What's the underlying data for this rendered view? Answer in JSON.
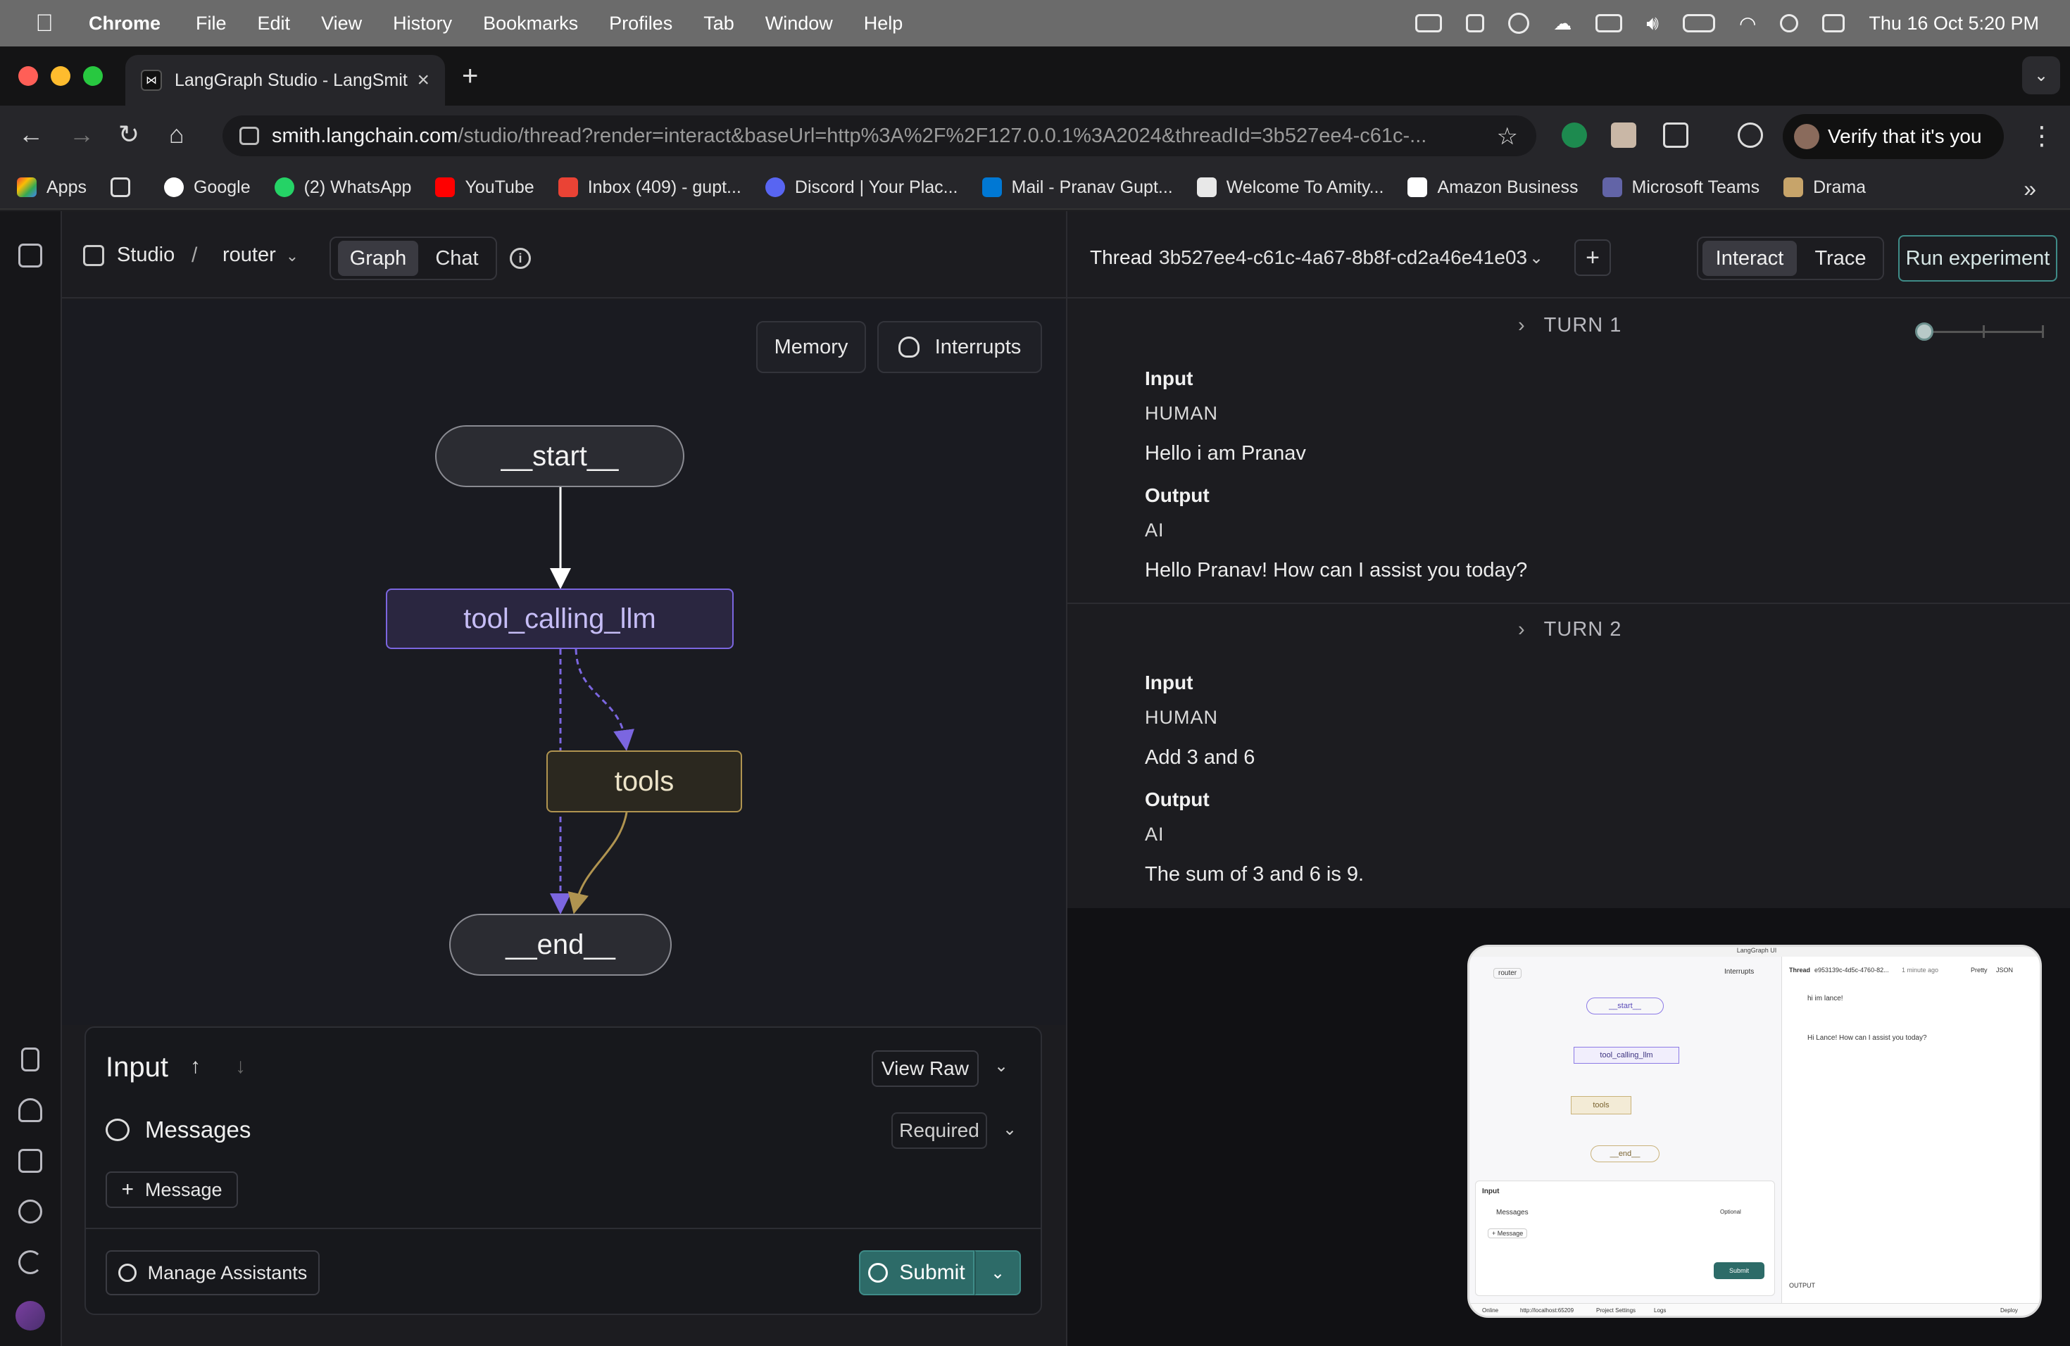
{
  "menubar": {
    "app_name": "Chrome",
    "menus": [
      "File",
      "Edit",
      "View",
      "History",
      "Bookmarks",
      "Profiles",
      "Tab",
      "Window",
      "Help"
    ],
    "clock": "Thu 16 Oct  5:20 PM"
  },
  "browser": {
    "tab_title": "LangGraph Studio - LangSmith",
    "url_host": "smith.langchain.com",
    "url_path": "/studio/thread?render=interact&baseUrl=http%3A%2F%2F127.0.0.1%3A2024&threadId=3b527ee4-c61c-...",
    "verify_label": "Verify that it's you",
    "bookmarks": [
      "Apps",
      "Google",
      "(2) WhatsApp",
      "YouTube",
      "Inbox (409) - gupt...",
      "Discord | Your Plac...",
      "Mail - Pranav Gupt...",
      "Welcome To Amity...",
      "Amazon Business",
      "Microsoft Teams",
      "Drama"
    ]
  },
  "studio": {
    "studio_label": "Studio",
    "separator": "/",
    "graph_name": "router",
    "mode_graph": "Graph",
    "mode_chat": "Chat",
    "memory_label": "Memory",
    "interrupts_label": "Interrupts",
    "nodes": {
      "start": "__start__",
      "llm": "tool_calling_llm",
      "tools": "tools",
      "end": "__end__"
    },
    "input": {
      "title": "Input",
      "view_raw": "View Raw",
      "messages_label": "Messages",
      "required_label": "Required",
      "add_message": "Message",
      "manage_assistants": "Manage Assistants",
      "submit": "Submit"
    }
  },
  "thread": {
    "label": "Thread",
    "id": "3b527ee4-c61c-4a67-8b8f-cd2a46e41e03",
    "tab_interact": "Interact",
    "tab_trace": "Trace",
    "run_experiment": "Run experiment",
    "turns": [
      {
        "header": "TURN 1",
        "input_label": "Input",
        "input_role": "HUMAN",
        "input_text": "Hello i am Pranav",
        "output_label": "Output",
        "output_role": "AI",
        "output_text": "Hello Pranav! How can I assist you today?"
      },
      {
        "header": "TURN 2",
        "input_label": "Input",
        "input_role": "HUMAN",
        "input_text": "Add 3 and 6",
        "output_label": "Output",
        "output_role": "AI",
        "output_text": "The sum of 3 and 6 is 9."
      }
    ]
  },
  "pip": {
    "title": "LangGraph UI",
    "graph_name": "router",
    "interrupts": "Interrupts",
    "thread_label": "Thread",
    "thread_id": "e953139c-4d5c-4760-82...",
    "thread_time": "1 minute ago",
    "tab_pretty": "Pretty",
    "tab_json": "JSON",
    "msg_human": "hi im lance!",
    "msg_ai": "Hi Lance! How can I assist you today?",
    "node_start": "__start__",
    "node_llm": "tool_calling_llm",
    "node_tools": "tools",
    "node_end": "__end__",
    "input_title": "Input",
    "messages": "Messages",
    "optional": "Optional",
    "add_message": "+ Message",
    "submit": "Submit",
    "output": "OUTPUT",
    "footer_online": "Online",
    "footer_url": "http://localhost:65209",
    "footer_settings": "Project Settings",
    "footer_logs": "Logs",
    "footer_deploy": "Deploy"
  },
  "colors": {
    "accent_teal": "#2d6b68",
    "llm_node_border": "#7b66e0",
    "tools_node_border": "#b09450"
  }
}
